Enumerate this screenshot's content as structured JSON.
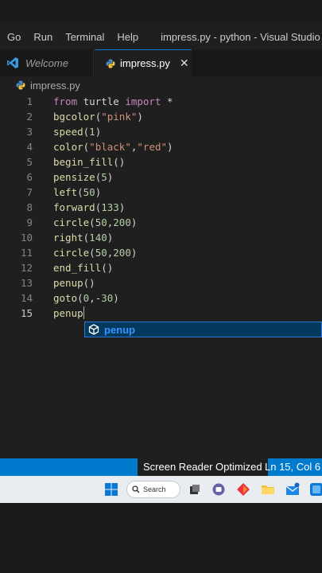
{
  "menu": {
    "items": [
      "Go",
      "Run",
      "Terminal",
      "Help"
    ],
    "window_title": "impress.py - python - Visual Studio Code"
  },
  "tabs": [
    {
      "label": "Welcome",
      "active": false
    },
    {
      "label": "impress.py",
      "active": true
    }
  ],
  "breadcrumb": "impress.py",
  "editor": {
    "line_numbers": [
      "1",
      "2",
      "3",
      "4",
      "5",
      "6",
      "7",
      "8",
      "9",
      "10",
      "11",
      "12",
      "13",
      "14",
      "15"
    ],
    "lines": [
      [
        {
          "t": "from",
          "c": "kw"
        },
        {
          "t": " turtle ",
          "c": "txt"
        },
        {
          "t": "import",
          "c": "kw"
        },
        {
          "t": " *",
          "c": "txt"
        }
      ],
      [
        {
          "t": "bgcolor",
          "c": "fn"
        },
        {
          "t": "(",
          "c": "txt"
        },
        {
          "t": "\"pink\"",
          "c": "str"
        },
        {
          "t": ")",
          "c": "txt"
        }
      ],
      [
        {
          "t": "speed",
          "c": "fn"
        },
        {
          "t": "(",
          "c": "txt"
        },
        {
          "t": "1",
          "c": "num"
        },
        {
          "t": ")",
          "c": "txt"
        }
      ],
      [
        {
          "t": "color",
          "c": "fn"
        },
        {
          "t": "(",
          "c": "txt"
        },
        {
          "t": "\"black\"",
          "c": "str"
        },
        {
          "t": ",",
          "c": "txt"
        },
        {
          "t": "\"red\"",
          "c": "str"
        },
        {
          "t": ")",
          "c": "txt"
        }
      ],
      [
        {
          "t": "begin_fill",
          "c": "fn"
        },
        {
          "t": "()",
          "c": "txt"
        }
      ],
      [
        {
          "t": "pensize",
          "c": "fn"
        },
        {
          "t": "(",
          "c": "txt"
        },
        {
          "t": "5",
          "c": "num"
        },
        {
          "t": ")",
          "c": "txt"
        }
      ],
      [
        {
          "t": "left",
          "c": "fn"
        },
        {
          "t": "(",
          "c": "txt"
        },
        {
          "t": "50",
          "c": "num"
        },
        {
          "t": ")",
          "c": "txt"
        }
      ],
      [
        {
          "t": "forward",
          "c": "fn"
        },
        {
          "t": "(",
          "c": "txt"
        },
        {
          "t": "133",
          "c": "num"
        },
        {
          "t": ")",
          "c": "txt"
        }
      ],
      [
        {
          "t": "circle",
          "c": "fn"
        },
        {
          "t": "(",
          "c": "txt"
        },
        {
          "t": "50",
          "c": "num"
        },
        {
          "t": ",",
          "c": "txt"
        },
        {
          "t": "200",
          "c": "num"
        },
        {
          "t": ")",
          "c": "txt"
        }
      ],
      [
        {
          "t": "right",
          "c": "fn"
        },
        {
          "t": "(",
          "c": "txt"
        },
        {
          "t": "140",
          "c": "num"
        },
        {
          "t": ")",
          "c": "txt"
        }
      ],
      [
        {
          "t": "circle",
          "c": "fn"
        },
        {
          "t": "(",
          "c": "txt"
        },
        {
          "t": "50",
          "c": "num"
        },
        {
          "t": ",",
          "c": "txt"
        },
        {
          "t": "200",
          "c": "num"
        },
        {
          "t": ")",
          "c": "txt"
        }
      ],
      [
        {
          "t": "end_fill",
          "c": "fn"
        },
        {
          "t": "()",
          "c": "txt"
        }
      ],
      [
        {
          "t": "penup",
          "c": "fn"
        },
        {
          "t": "()",
          "c": "txt"
        }
      ],
      [
        {
          "t": "goto",
          "c": "fn"
        },
        {
          "t": "(",
          "c": "txt"
        },
        {
          "t": "0",
          "c": "num"
        },
        {
          "t": ",-",
          "c": "txt"
        },
        {
          "t": "30",
          "c": "num"
        },
        {
          "t": ")",
          "c": "txt"
        }
      ],
      [
        {
          "t": "penup",
          "c": "fn"
        }
      ]
    ],
    "active_line": 15
  },
  "suggestion": {
    "label": "penup",
    "icon": "method-cube-icon"
  },
  "status": {
    "screen_reader": "Screen Reader Optimized",
    "cursor_position": "Ln 15, Col 6"
  },
  "taskbar": {
    "search_label": "Search"
  },
  "colors": {
    "accent": "#007acc",
    "keyword": "#c586c0",
    "function": "#dcdcaa",
    "string": "#ce9178",
    "number": "#b5cea8"
  }
}
